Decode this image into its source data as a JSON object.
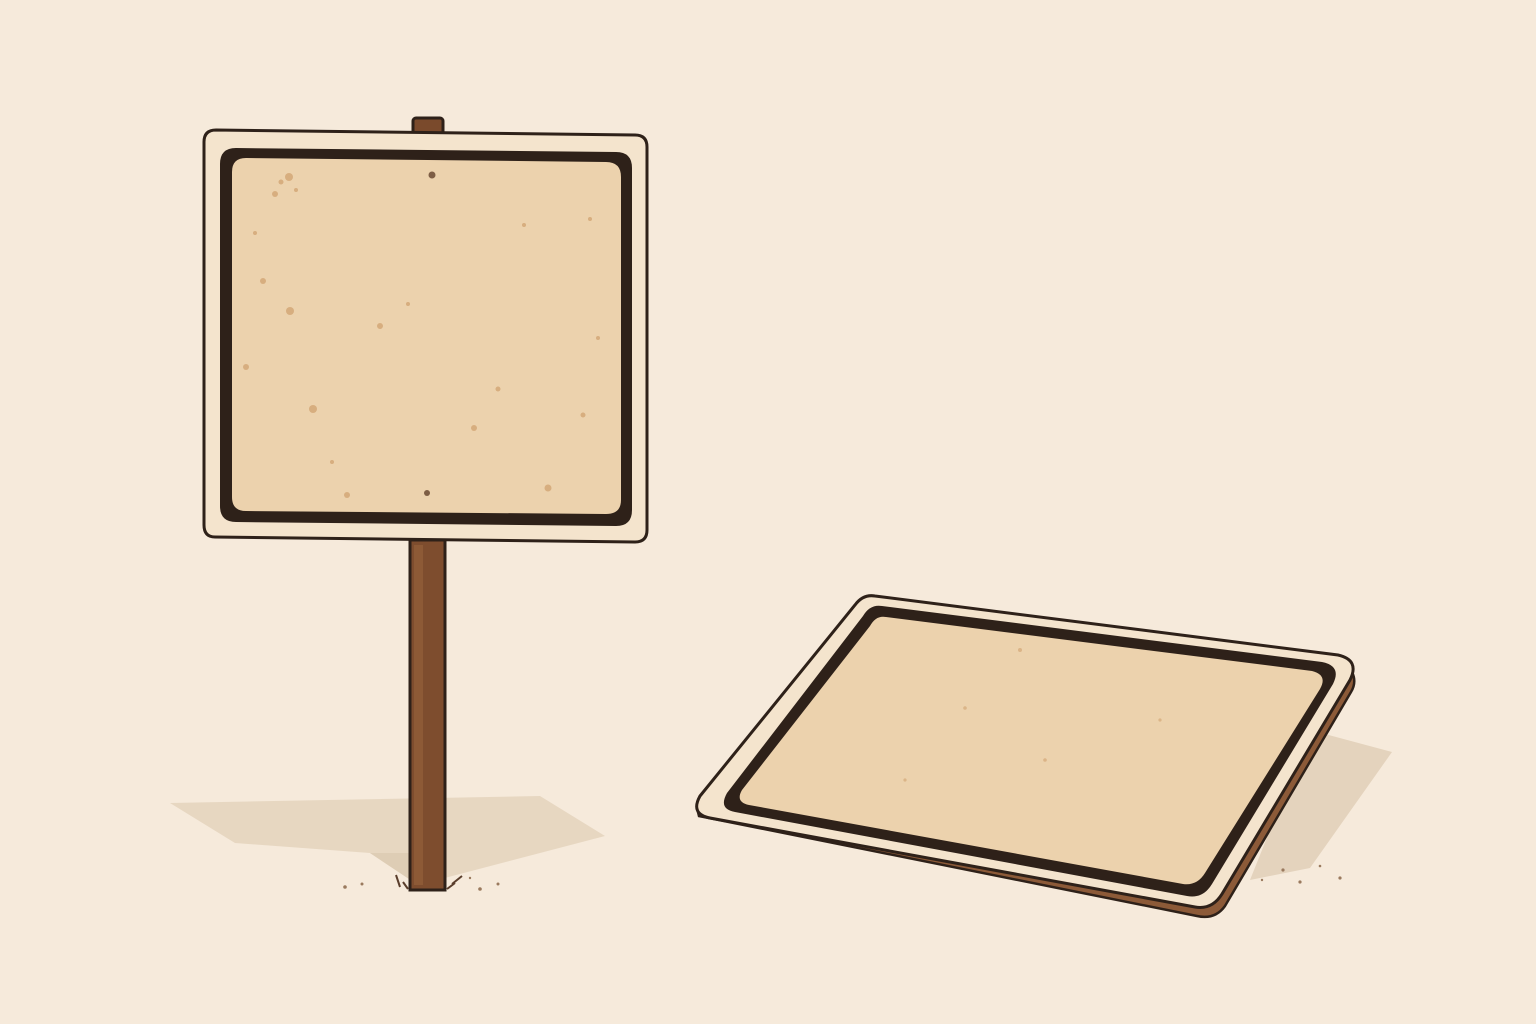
{
  "scene": {
    "background_color": "#f6eadb",
    "subject": "two blank signs",
    "signs": [
      {
        "kind": "standing-sign-on-post",
        "face_color": "#ecd1ac",
        "rim_color": "#f3e2cb",
        "border_color": "#2e2119",
        "post_color": "#7a4a2c",
        "label_text": ""
      },
      {
        "kind": "fallen-sign-on-ground",
        "face_color": "#ecd1ac",
        "rim_color": "#f3e2cb",
        "border_color": "#2e2119",
        "edge_color": "#8c5a38",
        "label_text": ""
      }
    ],
    "shadow_color": "#e4d3bd"
  }
}
